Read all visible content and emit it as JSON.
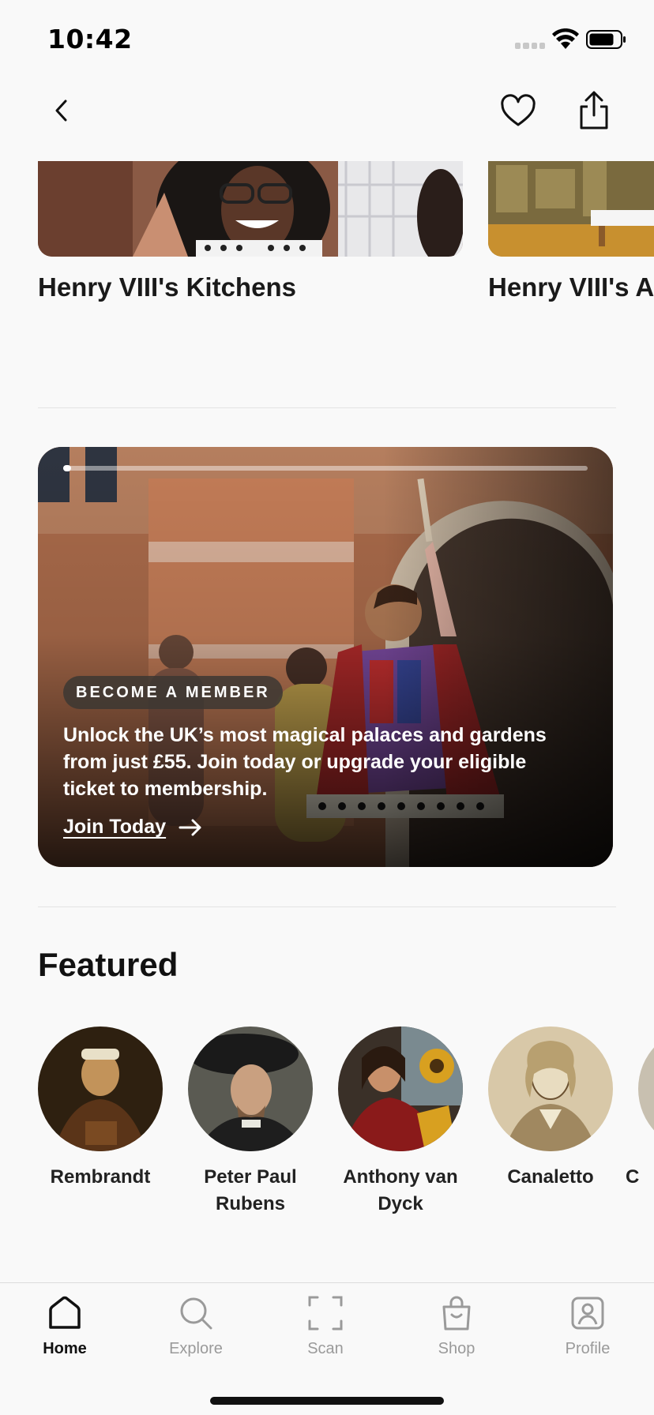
{
  "status": {
    "time": "10:42"
  },
  "carousel": [
    {
      "title": "Henry VIII's Kitchens"
    },
    {
      "title": "Henry VIII's Ap"
    }
  ],
  "banner": {
    "badge": "BECOME A MEMBER",
    "text": "Unlock the UK’s most magical palaces and gardens from just £55. Join today or upgrade your eligible ticket to membership.",
    "link": "Join Today",
    "progress": 0.01
  },
  "featured": {
    "title": "Featured",
    "artists": [
      {
        "name": "Rembrandt"
      },
      {
        "name": "Peter Paul Rubens"
      },
      {
        "name": "Anthony van Dyck"
      },
      {
        "name": "Canaletto"
      },
      {
        "name": "C"
      }
    ]
  },
  "tabs": [
    {
      "label": "Home",
      "icon": "home-icon",
      "active": true
    },
    {
      "label": "Explore",
      "icon": "search-icon",
      "active": false
    },
    {
      "label": "Scan",
      "icon": "scan-icon",
      "active": false
    },
    {
      "label": "Shop",
      "icon": "shopping-bag-icon",
      "active": false
    },
    {
      "label": "Profile",
      "icon": "profile-icon",
      "active": false
    }
  ],
  "colors": {
    "background": "#f9f9f9",
    "text": "#111111",
    "inactive": "#9a9a9a"
  }
}
